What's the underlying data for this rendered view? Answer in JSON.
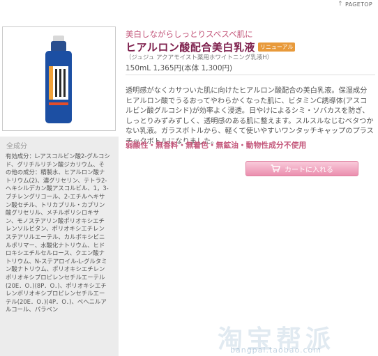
{
  "header": {
    "pagetop_label": "PAGETOP",
    "pagetop_icon": "arrow-up-icon"
  },
  "product": {
    "image_icon": "lotion-bottle",
    "catch_copy": "美白しながらしっとりスベスベ肌に",
    "title": "ヒアルロン酸配合美白乳液",
    "badge": "リニューアル",
    "subtitle": "（ジュジュ アクアモイスト薬用ホワイトニング乳液H）",
    "price": "150mL 1,365円(本体 1,300円)",
    "description": "透明感がなくカサついた肌に向けたヒアルロン酸配合の美白乳液。保湿成分ヒアルロン酸でうるおってやわらかくなった肌に、ビタミンC誘導体(アスコルビン酸グルコシド)が効率よく浸透。日やけによるシミ・ソバカスを防ぎ、しっとりみずみずしく、透明感のある肌に整えます。スルスルなじむベタつかない乳液。ガラスボトルから、軽くて使いやすいワンタッチキャップのプラスチックボトルになりました。",
    "features": "弱酸性・無香料・無着色・無鉱油・動物性成分不使用"
  },
  "ingredients": {
    "title": "全成分",
    "text": "有効成分：L-アスコルビン酸2-グルコシド、グリチルリチン酸ジカリウム、その他の成分：精製水、ヒアルロン酸ナトリウム(2)、濃グリセリン、テトラ2-ヘキシルデカン酸アスコルビル、1，3-ブチレングリコール、2-エチルヘキサン酸セチル、トリカプリル・カプリン酸グリセリル、メチルポリシロキサン、モノステアリン酸ポリオキシエチレンソルビタン、ポリオキシエチレンステアリルエーテル、カルボキシビニルポリマー、水酸化ナトリウム、ヒドロキシエチルセルロース、クエン酸ナトリウム、N-ステアロイル-L-グルタミン酸ナトリウム、ポリオキシエチレンポリオキシプロピレンセチルエーテル(20E．O．)(8P．O．)、ポリオキシエチレンポリオキシプロピレンセチルエーテル(20E．O．)(4P．O．)、ベヘニルアルコール、パラベン"
  },
  "cart": {
    "label": "カートに入れる",
    "icon": "cart-icon"
  },
  "watermark": {
    "main": "淘宝帮派",
    "url": "bangpai.taobao.com"
  },
  "colors": {
    "accent_pink": "#c3567a",
    "title_wine": "#7d1f4c",
    "badge_orange": "#e89a3b",
    "cart_pink": "#eb8eae",
    "bottle_blue": "#1c4fa3"
  }
}
